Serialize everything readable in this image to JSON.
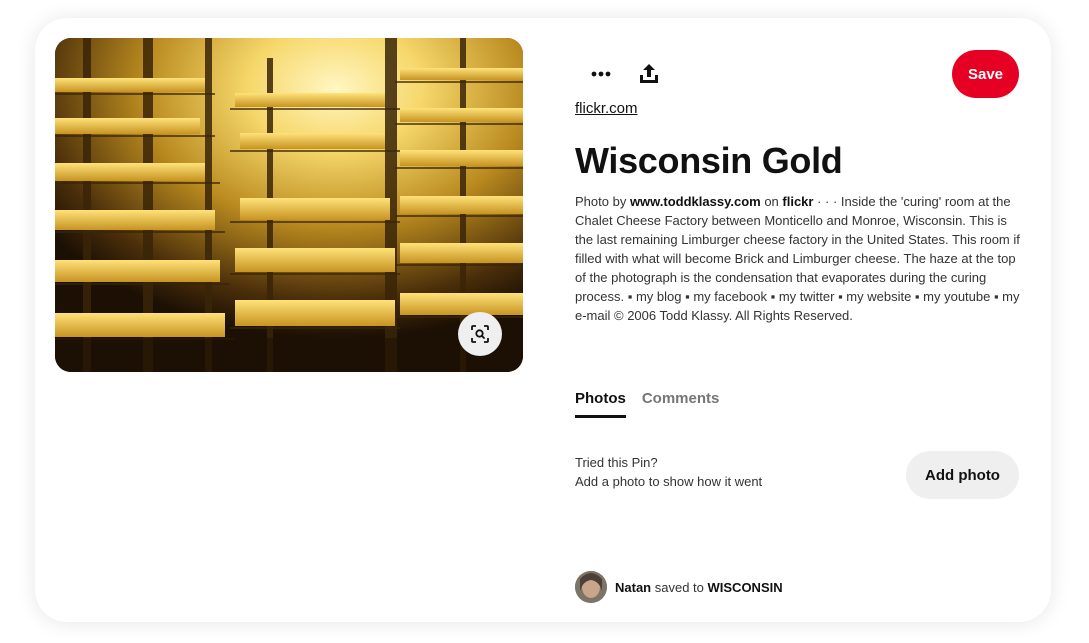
{
  "pin": {
    "image_alt": "Cheese curing racks glowing golden",
    "source": "flickr.com",
    "title": "Wisconsin Gold",
    "description": {
      "prefix": "Photo by ",
      "author": "www.toddklassy.com",
      "on": " on ",
      "site": "flickr",
      "body": " · · · Inside the 'curing' room at the Chalet Cheese Factory between Monticello and Monroe, Wisconsin. This is the last remaining Limburger cheese factory in the United States. This room if filled with what will become Brick and Limburger cheese. The haze at the top of the photograph is the condensation that evaporates during the curing process. ▪ my blog ▪ my facebook ▪ my twitter ▪ my website ▪ my youtube ▪ my e-mail © 2006 Todd Klassy. All Rights Reserved."
    }
  },
  "actions": {
    "more_icon": "more-icon",
    "share_icon": "share-icon",
    "save_label": "Save",
    "visual_search_icon": "visual-search-icon"
  },
  "tabs": [
    {
      "label": "Photos",
      "active": true
    },
    {
      "label": "Comments",
      "active": false
    }
  ],
  "tried": {
    "line1": "Tried this Pin?",
    "line2": "Add a photo to show how it went",
    "button": "Add photo"
  },
  "saved_by": {
    "user": "Natan",
    "middle": " saved to ",
    "board": "WISCONSIN"
  },
  "colors": {
    "save": "#e60023",
    "secondary_button": "#efefef"
  }
}
